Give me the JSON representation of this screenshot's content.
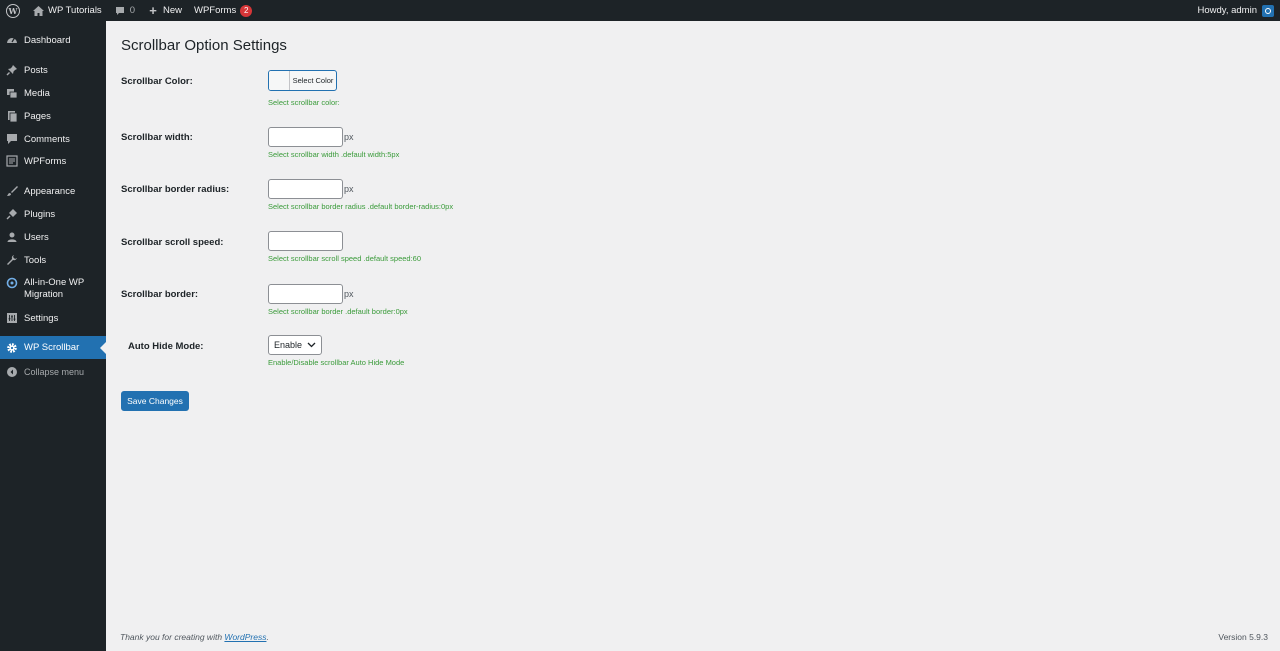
{
  "adminbar": {
    "site_name": "WP Tutorials",
    "comments_count": "0",
    "new_label": "New",
    "wpforms_label": "WPForms",
    "wpforms_badge": "2",
    "howdy": "Howdy, admin"
  },
  "sidebar": {
    "items": [
      {
        "label": "Dashboard",
        "icon": "dashboard-icon"
      },
      {
        "label": "Posts",
        "icon": "pin-icon"
      },
      {
        "label": "Media",
        "icon": "media-icon"
      },
      {
        "label": "Pages",
        "icon": "pages-icon"
      },
      {
        "label": "Comments",
        "icon": "comment-icon"
      },
      {
        "label": "WPForms",
        "icon": "form-icon"
      },
      {
        "label": "Appearance",
        "icon": "brush-icon"
      },
      {
        "label": "Plugins",
        "icon": "plug-icon"
      },
      {
        "label": "Users",
        "icon": "user-icon"
      },
      {
        "label": "Tools",
        "icon": "wrench-icon"
      },
      {
        "label": "All-in-One WP Migration",
        "icon": "migration-icon"
      },
      {
        "label": "Settings",
        "icon": "settings-icon"
      },
      {
        "label": "WP Scrollbar",
        "icon": "gear-icon",
        "active": true
      },
      {
        "label": "Collapse menu",
        "icon": "collapse-icon"
      }
    ]
  },
  "main": {
    "title": "Scrollbar Option Settings",
    "fields": {
      "color": {
        "label": "Scrollbar Color:",
        "button": "Select Color",
        "help": "Select scrollbar color:"
      },
      "width": {
        "label": "Scrollbar width:",
        "value": "",
        "unit": "px",
        "help": "Select scrollbar width .default width:5px"
      },
      "radius": {
        "label": "Scrollbar border radius:",
        "value": "",
        "unit": "px",
        "help": "Select scrollbar border radius .default border-radius:0px"
      },
      "speed": {
        "label": "Scrollbar scroll speed:",
        "value": "",
        "help": "Select scrollbar scroll speed .default speed:60"
      },
      "border": {
        "label": "Scrollbar border:",
        "value": "",
        "unit": "px",
        "help": "Select scrollbar border .default border:0px"
      },
      "autohide": {
        "label": "Auto Hide Mode:",
        "selected": "Enable",
        "help": "Enable/Disable scrollbar Auto Hide Mode"
      }
    },
    "save_label": "Save Changes"
  },
  "footer": {
    "thanks_prefix": "Thank you for creating with ",
    "thanks_link": "WordPress",
    "thanks_suffix": ".",
    "version": "Version 5.9.3"
  },
  "colors": {
    "adminbar_bg": "#1d2327",
    "accent": "#2271b1",
    "help_text": "#3a9b3a",
    "badge": "#d63638"
  }
}
